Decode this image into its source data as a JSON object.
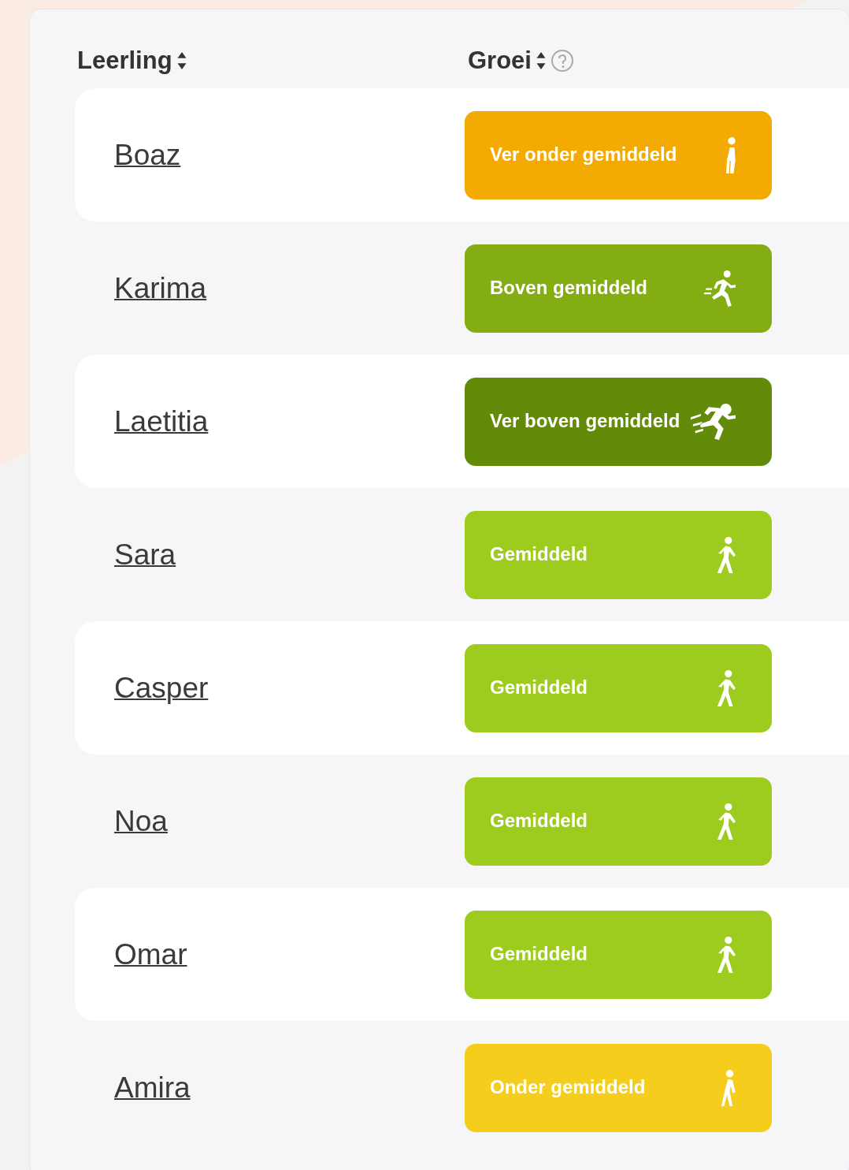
{
  "table": {
    "columns": [
      {
        "label": "Leerling",
        "sortable": true,
        "help": false
      },
      {
        "label": "Groei",
        "sortable": true,
        "help": true
      }
    ],
    "rows": [
      {
        "name": "Boaz",
        "growth": "Ver onder gemiddeld",
        "color": "#f3aa02",
        "kind": "stand"
      },
      {
        "name": "Karima",
        "growth": "Boven gemiddeld",
        "color": "#84ad14",
        "kind": "run"
      },
      {
        "name": "Laetitia",
        "growth": "Ver boven gemiddeld",
        "color": "#648a0a",
        "kind": "sprint"
      },
      {
        "name": "Sara",
        "growth": "Gemiddeld",
        "color": "#9ecc1e",
        "kind": "walk"
      },
      {
        "name": "Casper",
        "growth": "Gemiddeld",
        "color": "#9ecc1e",
        "kind": "walk"
      },
      {
        "name": "Noa",
        "growth": "Gemiddeld",
        "color": "#9ecc1e",
        "kind": "walk"
      },
      {
        "name": "Omar",
        "growth": "Gemiddeld",
        "color": "#9ecc1e",
        "kind": "walk"
      },
      {
        "name": "Amira",
        "growth": "Onder gemiddeld",
        "color": "#f5cd1c",
        "kind": "slow"
      }
    ]
  }
}
